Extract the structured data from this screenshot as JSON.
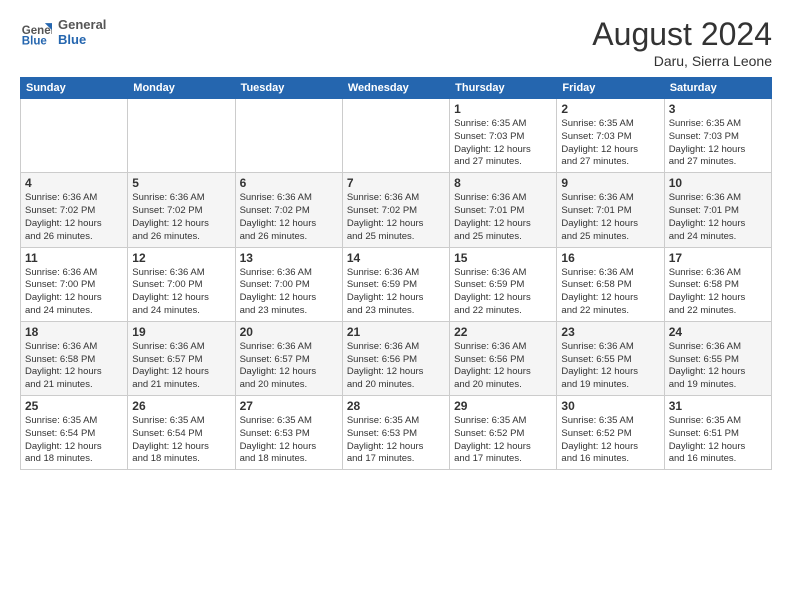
{
  "header": {
    "logo_general": "General",
    "logo_blue": "Blue",
    "title": "August 2024",
    "location": "Daru, Sierra Leone"
  },
  "days_of_week": [
    "Sunday",
    "Monday",
    "Tuesday",
    "Wednesday",
    "Thursday",
    "Friday",
    "Saturday"
  ],
  "weeks": [
    [
      {
        "day": "",
        "info": ""
      },
      {
        "day": "",
        "info": ""
      },
      {
        "day": "",
        "info": ""
      },
      {
        "day": "",
        "info": ""
      },
      {
        "day": "1",
        "info": "Sunrise: 6:35 AM\nSunset: 7:03 PM\nDaylight: 12 hours\nand 27 minutes."
      },
      {
        "day": "2",
        "info": "Sunrise: 6:35 AM\nSunset: 7:03 PM\nDaylight: 12 hours\nand 27 minutes."
      },
      {
        "day": "3",
        "info": "Sunrise: 6:35 AM\nSunset: 7:03 PM\nDaylight: 12 hours\nand 27 minutes."
      }
    ],
    [
      {
        "day": "4",
        "info": "Sunrise: 6:36 AM\nSunset: 7:02 PM\nDaylight: 12 hours\nand 26 minutes."
      },
      {
        "day": "5",
        "info": "Sunrise: 6:36 AM\nSunset: 7:02 PM\nDaylight: 12 hours\nand 26 minutes."
      },
      {
        "day": "6",
        "info": "Sunrise: 6:36 AM\nSunset: 7:02 PM\nDaylight: 12 hours\nand 26 minutes."
      },
      {
        "day": "7",
        "info": "Sunrise: 6:36 AM\nSunset: 7:02 PM\nDaylight: 12 hours\nand 25 minutes."
      },
      {
        "day": "8",
        "info": "Sunrise: 6:36 AM\nSunset: 7:01 PM\nDaylight: 12 hours\nand 25 minutes."
      },
      {
        "day": "9",
        "info": "Sunrise: 6:36 AM\nSunset: 7:01 PM\nDaylight: 12 hours\nand 25 minutes."
      },
      {
        "day": "10",
        "info": "Sunrise: 6:36 AM\nSunset: 7:01 PM\nDaylight: 12 hours\nand 24 minutes."
      }
    ],
    [
      {
        "day": "11",
        "info": "Sunrise: 6:36 AM\nSunset: 7:00 PM\nDaylight: 12 hours\nand 24 minutes."
      },
      {
        "day": "12",
        "info": "Sunrise: 6:36 AM\nSunset: 7:00 PM\nDaylight: 12 hours\nand 24 minutes."
      },
      {
        "day": "13",
        "info": "Sunrise: 6:36 AM\nSunset: 7:00 PM\nDaylight: 12 hours\nand 23 minutes."
      },
      {
        "day": "14",
        "info": "Sunrise: 6:36 AM\nSunset: 6:59 PM\nDaylight: 12 hours\nand 23 minutes."
      },
      {
        "day": "15",
        "info": "Sunrise: 6:36 AM\nSunset: 6:59 PM\nDaylight: 12 hours\nand 22 minutes."
      },
      {
        "day": "16",
        "info": "Sunrise: 6:36 AM\nSunset: 6:58 PM\nDaylight: 12 hours\nand 22 minutes."
      },
      {
        "day": "17",
        "info": "Sunrise: 6:36 AM\nSunset: 6:58 PM\nDaylight: 12 hours\nand 22 minutes."
      }
    ],
    [
      {
        "day": "18",
        "info": "Sunrise: 6:36 AM\nSunset: 6:58 PM\nDaylight: 12 hours\nand 21 minutes."
      },
      {
        "day": "19",
        "info": "Sunrise: 6:36 AM\nSunset: 6:57 PM\nDaylight: 12 hours\nand 21 minutes."
      },
      {
        "day": "20",
        "info": "Sunrise: 6:36 AM\nSunset: 6:57 PM\nDaylight: 12 hours\nand 20 minutes."
      },
      {
        "day": "21",
        "info": "Sunrise: 6:36 AM\nSunset: 6:56 PM\nDaylight: 12 hours\nand 20 minutes."
      },
      {
        "day": "22",
        "info": "Sunrise: 6:36 AM\nSunset: 6:56 PM\nDaylight: 12 hours\nand 20 minutes."
      },
      {
        "day": "23",
        "info": "Sunrise: 6:36 AM\nSunset: 6:55 PM\nDaylight: 12 hours\nand 19 minutes."
      },
      {
        "day": "24",
        "info": "Sunrise: 6:36 AM\nSunset: 6:55 PM\nDaylight: 12 hours\nand 19 minutes."
      }
    ],
    [
      {
        "day": "25",
        "info": "Sunrise: 6:35 AM\nSunset: 6:54 PM\nDaylight: 12 hours\nand 18 minutes."
      },
      {
        "day": "26",
        "info": "Sunrise: 6:35 AM\nSunset: 6:54 PM\nDaylight: 12 hours\nand 18 minutes."
      },
      {
        "day": "27",
        "info": "Sunrise: 6:35 AM\nSunset: 6:53 PM\nDaylight: 12 hours\nand 18 minutes."
      },
      {
        "day": "28",
        "info": "Sunrise: 6:35 AM\nSunset: 6:53 PM\nDaylight: 12 hours\nand 17 minutes."
      },
      {
        "day": "29",
        "info": "Sunrise: 6:35 AM\nSunset: 6:52 PM\nDaylight: 12 hours\nand 17 minutes."
      },
      {
        "day": "30",
        "info": "Sunrise: 6:35 AM\nSunset: 6:52 PM\nDaylight: 12 hours\nand 16 minutes."
      },
      {
        "day": "31",
        "info": "Sunrise: 6:35 AM\nSunset: 6:51 PM\nDaylight: 12 hours\nand 16 minutes."
      }
    ]
  ]
}
